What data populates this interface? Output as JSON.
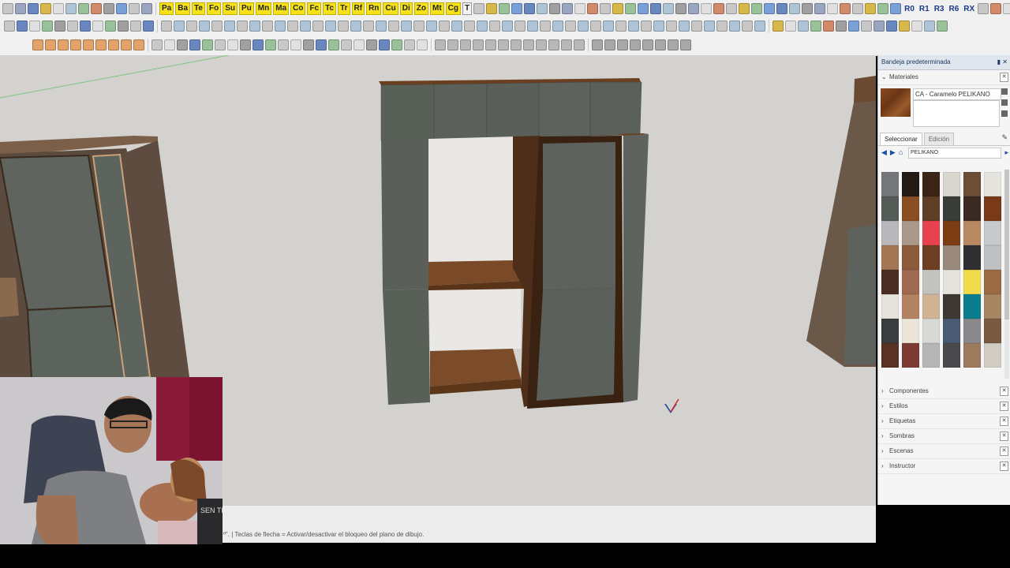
{
  "toolbar": {
    "row1_yellow": [
      "Pa",
      "Ba",
      "Te",
      "Fo",
      "Su",
      "Pu",
      "Mn",
      "Ma",
      "Co",
      "Fc",
      "Tc",
      "Tr",
      "Rf",
      "Rn",
      "Cu",
      "Di",
      "Zo",
      "Mt",
      "Cg"
    ],
    "row1_right": [
      "R0",
      "R1",
      "R3",
      "R6",
      "RX"
    ],
    "text_tool": "T"
  },
  "viewport": {
    "background": "#d3d2cf",
    "panel_color": "#5d625c",
    "wood_color": "#6d4325"
  },
  "status": {
    "text": "º\". | Teclas de flecha = Activar/desactivar el bloqueo del plano de dibujo."
  },
  "webcam": {
    "shirt_print": "SEN TI OS"
  },
  "tray": {
    "title": "Bandeja predeterminada",
    "materials": {
      "section": "Materiales",
      "current_name": "CA - Caramelo PELIKANO",
      "tab_select": "Seleccionar",
      "tab_edit": "Edición",
      "library": "PELIKANO",
      "swatches": [
        "#75777a",
        "#231a14",
        "#3a2415",
        "#d9d6d0",
        "#6a4e36",
        "#e6e4df",
        "#555c58",
        "#8b4e22",
        "#5e3e24",
        "#3a3c3a",
        "#3b2a22",
        "#7a3a18",
        "#b9b9bb",
        "#aa9888",
        "#e8424e",
        "#7c3c14",
        "#b88a62",
        "#c7c9cc",
        "#a47654",
        "#8a5a3a",
        "#6e3e22",
        "#9a8a7e",
        "#2e3032",
        "#bfc0c2",
        "#4a2e24",
        "#a06a52",
        "#c4c2be",
        "#e4e4dc",
        "#f0dc4a",
        "#9a6a42",
        "#e6e3dd",
        "#b48462",
        "#d2b494",
        "#3e3834",
        "#0a7e8e",
        "#a88664",
        "#3a3c3e",
        "#ece6da",
        "#d8d8d4",
        "#4a5a72",
        "#8a8a8e",
        "#7a5a42",
        "#5a3224",
        "#7c3a32",
        "#b6b6b6",
        "#4a4a4c",
        "#9c7a5c",
        "#d0ccc4"
      ]
    },
    "sections": [
      "Componentes",
      "Estilos",
      "Etiquetas",
      "Sombras",
      "Escenas",
      "Instructor"
    ]
  }
}
